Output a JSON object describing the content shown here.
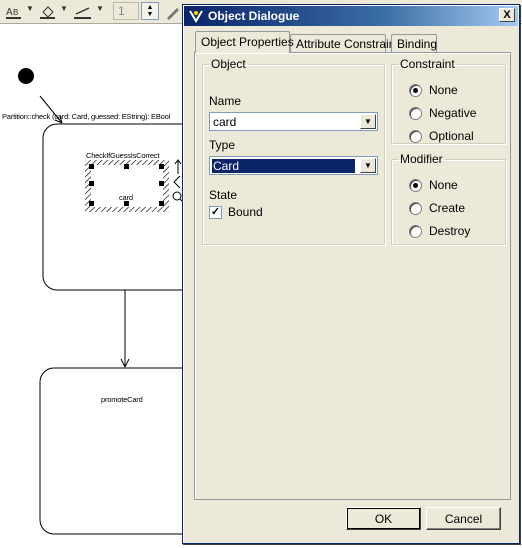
{
  "toolbar": {
    "zoom_value": "1",
    "icons": [
      "text-style-icon",
      "fill-color-icon",
      "line-color-icon",
      "zoom-stepper",
      "edit-tool-icon"
    ]
  },
  "diagram": {
    "transition_label": "Partition::check (card: Card, guessed: EString): EBool",
    "states": [
      {
        "name": "CheckIfGuessIsCorrect"
      },
      {
        "name": "promoteCard"
      }
    ],
    "object_label": "card"
  },
  "dialog": {
    "title": "Object Dialogue",
    "close_label": "X",
    "tabs": [
      {
        "label": "Object Properties",
        "active": true
      },
      {
        "label": "Attribute Constraint",
        "active": false
      },
      {
        "label": "Binding",
        "active": false
      }
    ],
    "object_group": {
      "legend": "Object",
      "name_label": "Name",
      "name_value": "card",
      "type_label": "Type",
      "type_value": "Card",
      "state_label": "State",
      "bound_label": "Bound",
      "bound_checked": true
    },
    "constraint_group": {
      "legend": "Constraint",
      "options": [
        "None",
        "Negative",
        "Optional"
      ],
      "selected": "None"
    },
    "modifier_group": {
      "legend": "Modifier",
      "options": [
        "None",
        "Create",
        "Destroy"
      ],
      "selected": "None"
    },
    "ok_label": "OK",
    "cancel_label": "Cancel"
  },
  "colors": {
    "dialog_face": "#ece9d8",
    "titlebar": "#0a246a",
    "selection": "#0a246a",
    "field_border": "#7f9db9"
  }
}
